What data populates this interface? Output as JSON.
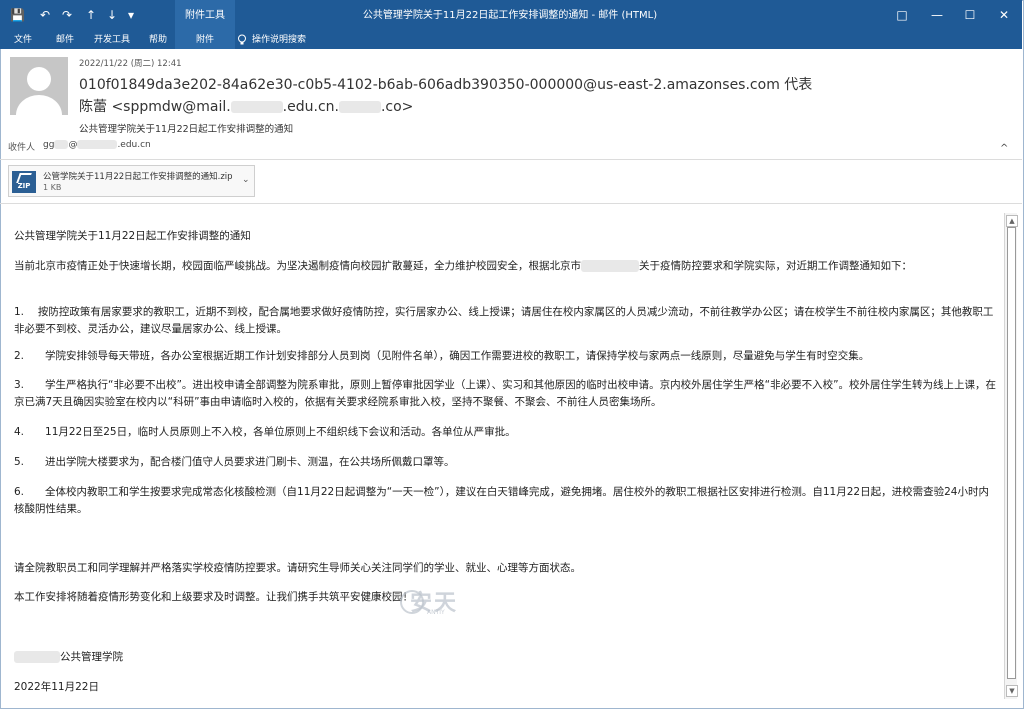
{
  "window": {
    "title": "公共管理学院关于11月22日起工作安排调整的通知 - 邮件 (HTML)",
    "context_tab": "附件工具",
    "buttons": {
      "ribbon_display": "□",
      "minimize": "—",
      "maximize": "☐",
      "close": "✕"
    }
  },
  "quick_access": [
    "💾",
    "↶",
    "↷",
    "↑",
    "↓",
    "▾"
  ],
  "ribbon": {
    "tabs": [
      "文件",
      "邮件",
      "开发工具",
      "帮助",
      "附件"
    ],
    "active_tab": "附件",
    "search_placeholder": "操作说明搜索"
  },
  "message": {
    "date": "2022/11/22 (周二) 12:41",
    "from_line1": "010f01849da3e202-84a62e30-c0b5-4102-b6ab-606adb390350-000000@us-east-2.amazonses.com 代表",
    "from_line2_prefix": "陈蕾 <sppmdw@mail.",
    "from_line2_mid": ".edu.cn.",
    "from_line2_end": ".co>",
    "subject": "公共管理学院关于11月22日起工作安排调整的通知",
    "to_label": "收件人",
    "to_value_prefix": "gg",
    "to_value_at": "@",
    "to_value_domain": ".edu.cn"
  },
  "attachment": {
    "name": "公管学院关于11月22日起工作安排调整的通知.zip",
    "size": "1 KB",
    "icon_text": "ZIP"
  },
  "body": {
    "title": "公共管理学院关于11月22日起工作安排调整的通知",
    "intro_a": "当前北京市疫情正处于快速增长期，校园面临严峻挑战。为坚决遏制疫情向校园扩散蔓延，全力维护校园安全，根据北京市",
    "intro_b": "关于疫情防控要求和学院实际，对近期工作调整通知如下：",
    "items": [
      "1.　 按防控政策有居家要求的教职工，近期不到校，配合属地要求做好疫情防控，实行居家办公、线上授课；请居住在校内家属区的人员减少流动，不前往教学办公区；请在校学生不前往校内家属区；其他教职工非必要不到校、灵活办公，建议尽量居家办公、线上授课。",
      "2.　　学院安排领导每天带班，各办公室根据近期工作计划安排部分人员到岗（见附件名单），确因工作需要进校的教职工，请保持学校与家两点一线原则，尽量避免与学生有时空交集。",
      "3.　　学生严格执行“非必要不出校”。进出校申请全部调整为院系审批，原则上暂停审批因学业（上课）、实习和其他原因的临时出校申请。京内校外居住学生严格“非必要不入校”。校外居住学生转为线上上课，在京已满7天且确因实验室在校内以“科研”事由申请临时入校的，依据有关要求经院系审批入校，坚持不聚餐、不聚会、不前往人员密集场所。",
      "4.　　11月22日至25日，临时人员原则上不入校，各单位原则上不组织线下会议和活动。各单位从严审批。",
      "5.　　进出学院大楼要求为，配合楼门值守人员要求进门刷卡、测温，在公共场所佩戴口罩等。",
      "6.　　全体校内教职工和学生按要求完成常态化核酸检测（自11月22日起调整为“一天一检”），建议在白天错峰完成，避免拥堵。居住校外的教职工根据社区安排进行检测。自11月22日起，进校需查验24小时内核酸阴性结果。"
    ],
    "closing1": "请全院教职员工和同学理解并严格落实学校疫情防控要求。请研究生导师关心关注同学们的学业、就业、心理等方面状态。",
    "closing2": "本工作安排将随着疫情形势变化和上级要求及时调整。让我们携手共筑平安健康校园！",
    "signature": "公共管理学院",
    "date": "2022年11月22日"
  },
  "watermark": {
    "text": "安天",
    "sub": "ANTIY"
  }
}
